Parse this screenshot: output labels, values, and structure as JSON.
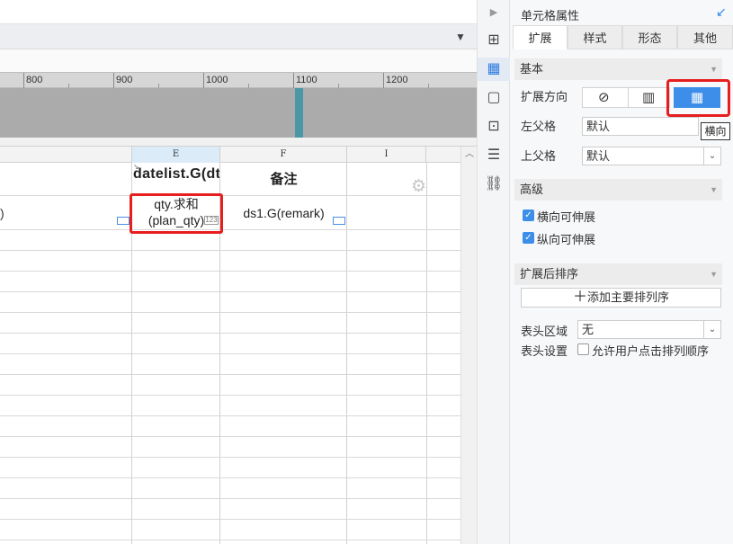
{
  "ruler": {
    "marks": [
      "800",
      "900",
      "1000",
      "1100",
      "1200"
    ]
  },
  "grid": {
    "columns": [
      "E",
      "F",
      "I"
    ],
    "cells": {
      "e1": "datelist.G(dt)",
      "f1": "备注",
      "d2": ")",
      "e2": "qty.求和(plan_qty)",
      "e2_badge": "123",
      "f2": "ds1.G(remark)"
    }
  },
  "panel": {
    "title": "单元格属性",
    "tabs": [
      "扩展",
      "样式",
      "形态",
      "其他"
    ],
    "active_tab": "扩展",
    "basic": {
      "section_title": "基本",
      "expand_direction_label": "扩展方向",
      "expand_direction_selected": "横向",
      "tooltip": "横向",
      "left_parent_label": "左父格",
      "left_parent_value": "默认",
      "top_parent_label": "上父格",
      "top_parent_value": "默认"
    },
    "advanced": {
      "section_title": "高级",
      "horizontal_extensible": "横向可伸展",
      "horizontal_extensible_checked": true,
      "vertical_extensible": "纵向可伸展",
      "vertical_extensible_checked": true
    },
    "sort": {
      "section_title": "扩展后排序",
      "add_button": "添加主要排列序"
    },
    "header": {
      "area_label": "表头区域",
      "area_value": "无",
      "settings_label": "表头设置",
      "allow_sort_label": "允许用户点击排列顺序",
      "allow_sort_checked": false
    }
  },
  "colors": {
    "accent": "#3d8ee8",
    "highlight": "#e61e1e",
    "canvas_marker": "#4a98a6"
  }
}
